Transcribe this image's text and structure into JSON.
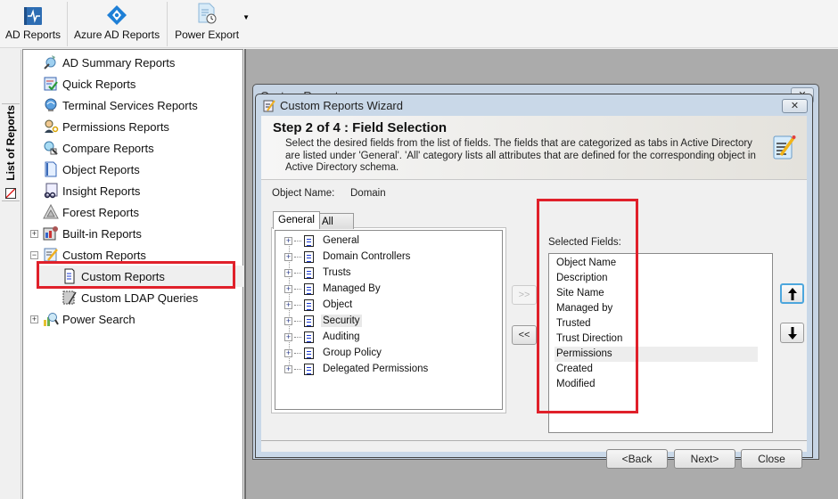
{
  "toolbar": {
    "buttons": [
      {
        "label": "AD Reports",
        "icon": "ad-reports-icon"
      },
      {
        "label": "Azure AD Reports",
        "icon": "azure-icon"
      },
      {
        "label": "Power Export",
        "icon": "power-export-icon",
        "has_dropdown": true
      }
    ]
  },
  "sidetab": {
    "label": "List of Reports"
  },
  "tree": {
    "items": [
      {
        "label": "AD Summary Reports",
        "icon": "ad-summary-icon"
      },
      {
        "label": "Quick Reports",
        "icon": "quick-reports-icon"
      },
      {
        "label": "Terminal Services Reports",
        "icon": "terminal-services-icon"
      },
      {
        "label": "Permissions Reports",
        "icon": "permissions-icon"
      },
      {
        "label": "Compare Reports",
        "icon": "compare-icon"
      },
      {
        "label": "Object Reports",
        "icon": "object-icon"
      },
      {
        "label": "Insight Reports",
        "icon": "insight-icon"
      },
      {
        "label": "Forest Reports",
        "icon": "forest-icon"
      },
      {
        "label": "Built-in Reports",
        "icon": "built-in-icon",
        "expander": "+"
      },
      {
        "label": "Custom Reports",
        "icon": "custom-reports-icon",
        "expander": "−"
      },
      {
        "label": "Custom Reports",
        "icon": "document-icon",
        "child": true,
        "selected": true
      },
      {
        "label": "Custom LDAP Queries",
        "icon": "ldap-icon",
        "child": true
      },
      {
        "label": "Power Search",
        "icon": "power-search-icon",
        "expander": "+"
      }
    ]
  },
  "outer_dialog": {
    "title": "Custom Reports",
    "close": "✕"
  },
  "wizard": {
    "title": "Custom Reports Wizard",
    "close": "✕",
    "step_title": "Step 2 of 4  : Field Selection",
    "description": "Select the desired fields from the list of fields. The fields that are categorized as tabs in Active Directory are listed under 'General'. 'All' category lists all attributes that are defined for the corresponding object in Active Directory schema.",
    "object_name_label": "Object Name:",
    "object_name_value": "Domain",
    "tabs": [
      {
        "label": "General",
        "active": true
      },
      {
        "label": "All",
        "active": false
      }
    ],
    "field_categories": [
      "General",
      "Domain Controllers",
      "Trusts",
      "Managed By",
      "Object",
      "Security",
      "Auditing",
      "Group Policy",
      "Delegated Permissions"
    ],
    "highlighted_category": "Security",
    "add_button": ">>",
    "remove_button": "<<",
    "selected_fields_label": "Selected Fields:",
    "selected_fields": [
      "Object Name",
      "Description",
      "Site Name",
      "Managed by",
      "Trusted",
      "Trust Direction",
      "Permissions",
      "Created",
      "Modified"
    ],
    "highlighted_field": "Permissions",
    "move_up": "↑",
    "move_down": "↓",
    "back_button": "<Back",
    "next_button": "Next>",
    "close_button": "Close"
  },
  "colors": {
    "highlight_box": "#e0202a",
    "focus_border": "#4ca6dd",
    "doc_icon_lines": "#1a3ad0"
  }
}
